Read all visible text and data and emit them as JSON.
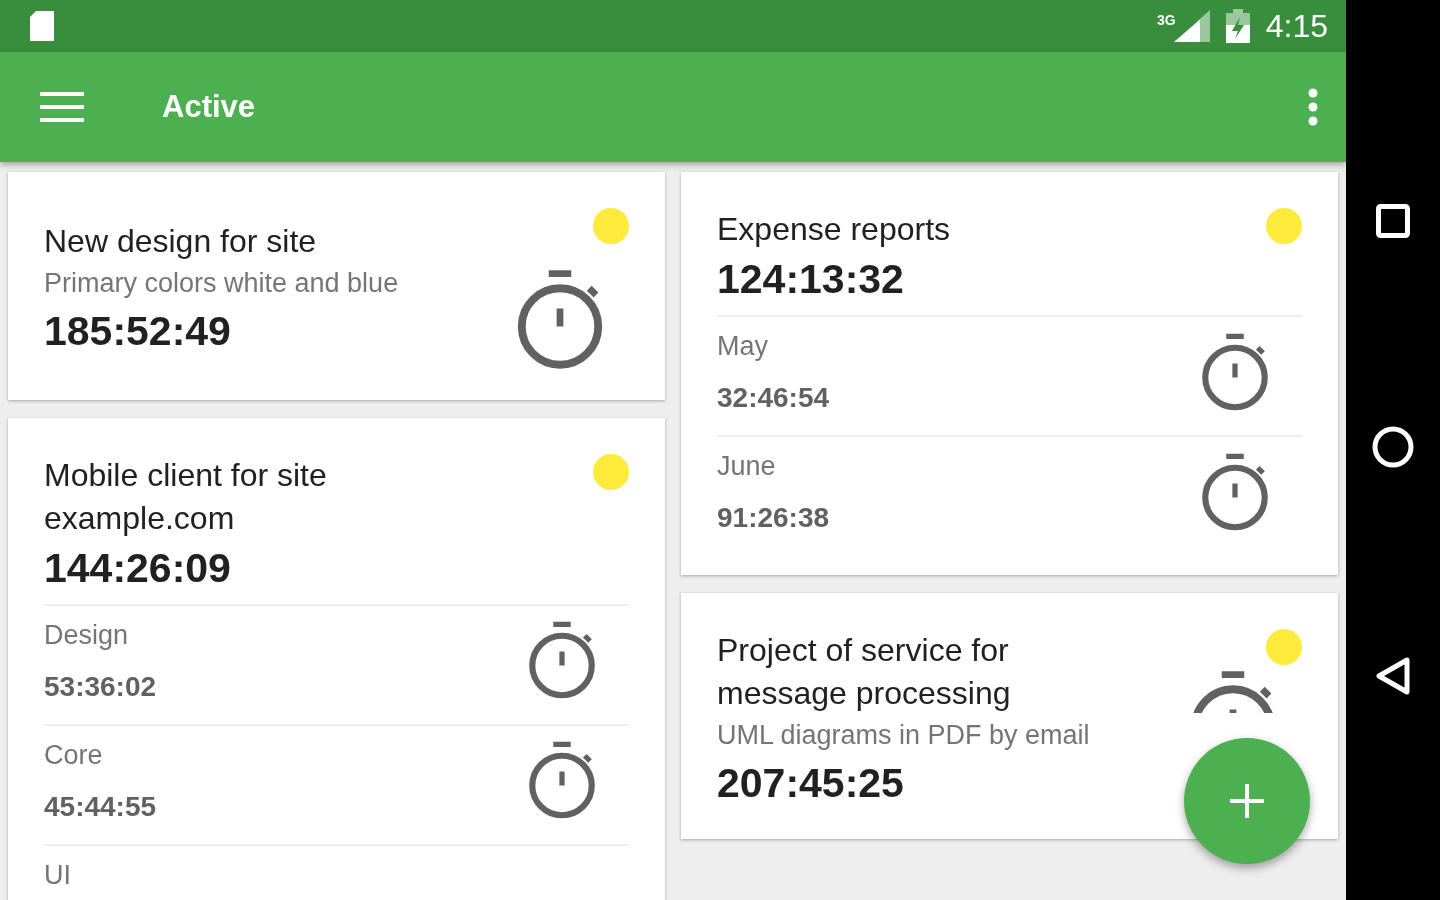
{
  "status_bar": {
    "network": "3G",
    "time": "4:15"
  },
  "app_bar": {
    "title": "Active"
  },
  "columns": [
    [
      {
        "title": "New design for site",
        "subtitle": "Primary colors white and blue",
        "time": "185:52:49"
      },
      {
        "title": "Mobile client for site example.com",
        "time": "144:26:09",
        "entries": [
          {
            "label": "Design",
            "time": "53:36:02"
          },
          {
            "label": "Core",
            "time": "45:44:55"
          },
          {
            "label": "UI"
          }
        ]
      }
    ],
    [
      {
        "title": "Expense reports",
        "time": "124:13:32",
        "entries": [
          {
            "label": "May",
            "time": "32:46:54"
          },
          {
            "label": "June",
            "time": "91:26:38"
          }
        ]
      },
      {
        "title": "Project of service for message processing",
        "subtitle": "UML diagrams in PDF by email",
        "time": "207:45:25"
      }
    ]
  ]
}
